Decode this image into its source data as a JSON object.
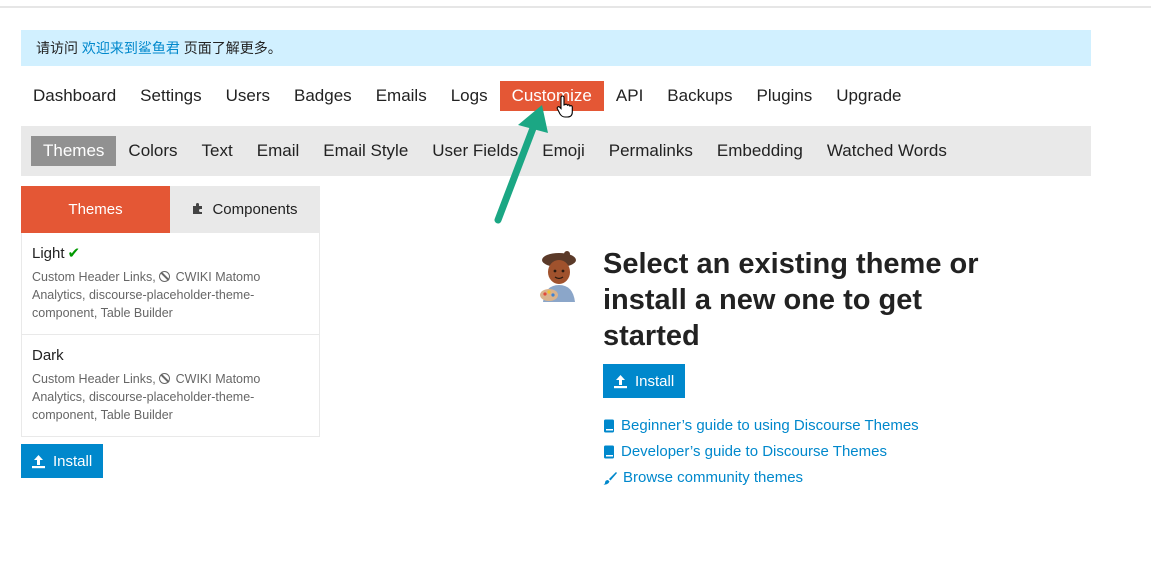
{
  "notice": {
    "prefix": "请访问",
    "link": "欢迎来到鲨鱼君",
    "suffix": "页面了解更多。"
  },
  "main_nav": {
    "items": [
      "Dashboard",
      "Settings",
      "Users",
      "Badges",
      "Emails",
      "Logs",
      "Customize",
      "API",
      "Backups",
      "Plugins",
      "Upgrade"
    ],
    "active": "Customize"
  },
  "sub_nav": {
    "items": [
      "Themes",
      "Colors",
      "Text",
      "Email",
      "Email Style",
      "User Fields",
      "Emoji",
      "Permalinks",
      "Embedding",
      "Watched Words"
    ],
    "active": "Themes"
  },
  "tabs": {
    "themes": "Themes",
    "components": "Components"
  },
  "themes": [
    {
      "name": "Light",
      "selected": true,
      "components_before": "Custom Header Links, ",
      "components_after": "CWIKI Matomo Analytics, discourse-placeholder-theme-component, Table Builder"
    },
    {
      "name": "Dark",
      "selected": false,
      "components_before": "Custom Header Links, ",
      "components_after": "CWIKI Matomo Analytics, discourse-placeholder-theme-component, Table Builder"
    }
  ],
  "install_label": "Install",
  "headline": "Select an existing theme or install a new one to get started",
  "links": [
    {
      "label": "Beginner’s guide to using Discourse Themes",
      "icon": "book-icon"
    },
    {
      "label": "Developer’s guide to Discourse Themes",
      "icon": "book-icon"
    },
    {
      "label": "Browse community themes",
      "icon": "paintbrush-icon"
    }
  ],
  "colors": {
    "accent": "#e45735",
    "primary_button": "#0088cc",
    "notice_bg": "#d1f0ff",
    "arrow": "#1ba784"
  }
}
